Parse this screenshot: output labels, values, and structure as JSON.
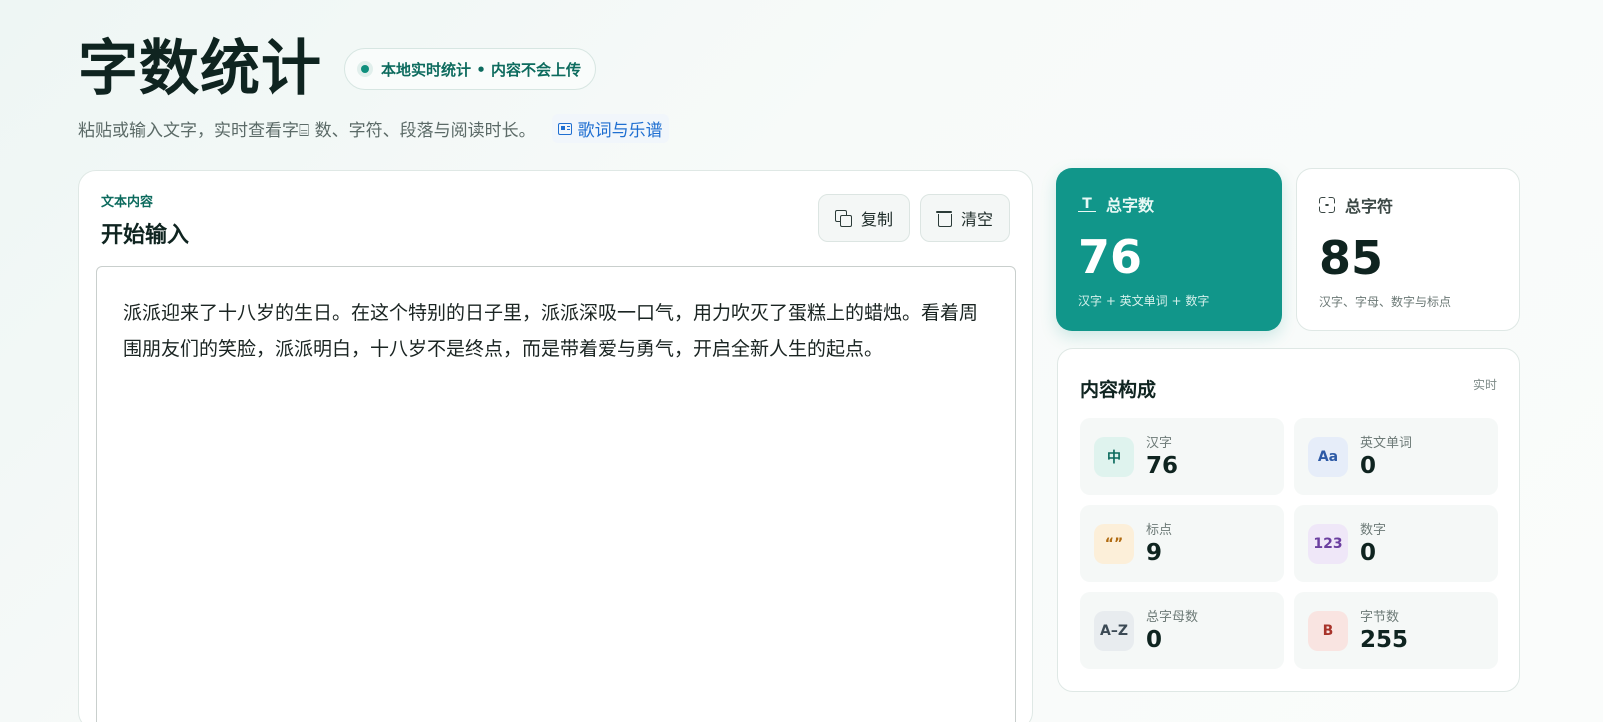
{
  "header": {
    "title": "字数统计",
    "privacy_badge": "本地实时统计 • 内容不会上传",
    "subtitle": "粘贴或输入文字，实时查看字⌸ 数、字符、段落与阅读时长。",
    "lyrics_link": "歌词与乐谱"
  },
  "editor": {
    "kicker": "文本内容",
    "title": "开始输入",
    "copy_label": "复制",
    "clear_label": "清空",
    "text": "派派迎来了十八岁的生日。在这个特别的日子里，派派深吸一口气，用力吹灭了蛋糕上的蜡烛。看着周围朋友们的笑脸，派派明白，十八岁不是终点，而是带着爱与勇气，开启全新人生的起点。"
  },
  "stats": {
    "words": {
      "label": "总字数",
      "value": "76",
      "sub": "汉字 + 英文单词 + 数字",
      "icon": "text-size-icon"
    },
    "chars": {
      "label": "总字符",
      "value": "85",
      "sub": "汉字、字母、数字与标点",
      "icon": "scan-icon"
    }
  },
  "composition": {
    "title": "内容构成",
    "live": "实时",
    "items": [
      {
        "icon": "中",
        "label": "汉字",
        "value": "76",
        "icon_bg": "#dff3ee",
        "icon_color": "#0d6b5e"
      },
      {
        "icon": "Aa",
        "label": "英文单词",
        "value": "0",
        "icon_bg": "#e6edf9",
        "icon_color": "#2d5aa6"
      },
      {
        "icon": "“”",
        "label": "标点",
        "value": "9",
        "icon_bg": "#fcefd9",
        "icon_color": "#b06a10"
      },
      {
        "icon": "123",
        "label": "数字",
        "value": "0",
        "icon_bg": "#efe7f8",
        "icon_color": "#6b3fa0"
      },
      {
        "icon": "A–Z",
        "label": "总字母数",
        "value": "0",
        "icon_bg": "#e8ecef",
        "icon_color": "#3c4a55"
      },
      {
        "icon": "B",
        "label": "字节数",
        "value": "255",
        "icon_bg": "#f9e4e1",
        "icon_color": "#a8332a"
      }
    ]
  }
}
